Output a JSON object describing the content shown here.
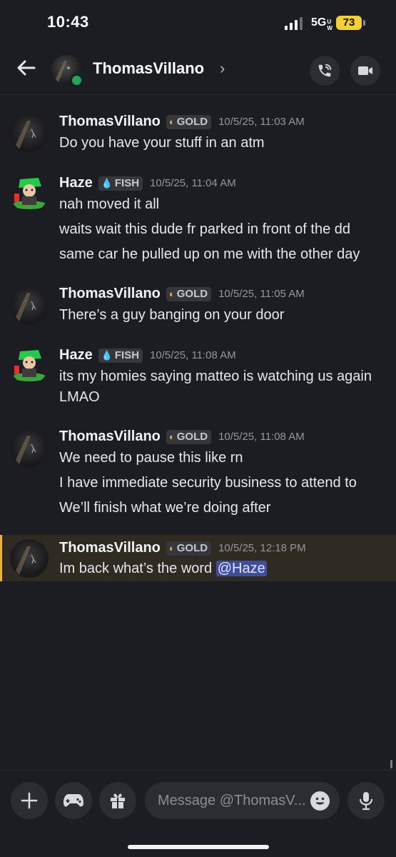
{
  "status_bar": {
    "time": "10:43",
    "network": "5G",
    "network_suffix": "UW",
    "battery": "73"
  },
  "header": {
    "name": "ThomasVillano",
    "chevron": "›"
  },
  "messages": [
    {
      "author": "ThomasVillano",
      "tag": "GOLD",
      "timestamp": "10/5/25, 11:03 AM",
      "lines": [
        "Do you have your stuff in an atm"
      ]
    },
    {
      "author": "Haze",
      "tag": "FISH",
      "timestamp": "10/5/25, 11:04 AM",
      "lines": [
        "nah moved it all",
        "waits wait this dude fr parked in front of the dd",
        "same car he pulled up on me with the other day"
      ]
    },
    {
      "author": "ThomasVillano",
      "tag": "GOLD",
      "timestamp": "10/5/25, 11:05 AM",
      "lines": [
        "There’s a guy banging on your door"
      ]
    },
    {
      "author": "Haze",
      "tag": "FISH",
      "timestamp": "10/5/25, 11:08 AM",
      "lines": [
        "its my homies saying matteo is watching us again",
        "LMAO"
      ]
    },
    {
      "author": "ThomasVillano",
      "tag": "GOLD",
      "timestamp": "10/5/25, 11:08 AM",
      "lines": [
        "We need to pause this like rn",
        "I have immediate security business to attend to",
        "We’ll finish what we’re doing after"
      ]
    },
    {
      "author": "ThomasVillano",
      "tag": "GOLD",
      "timestamp": "10/5/25, 12:18 PM",
      "lines": [
        "Im back what’s the word "
      ],
      "mention": "@Haze"
    }
  ],
  "composer": {
    "placeholder": "Message @ThomasV..."
  },
  "colors": {
    "background": "#1c1d22",
    "gold_tag": "#f0b232",
    "fish_tag": "#5fc1e8",
    "mention_bg": "#414d99",
    "online": "#23a55a"
  },
  "icons": [
    "back-arrow-icon",
    "chevron-right-icon",
    "phone-call-icon",
    "video-camera-icon",
    "plus-icon",
    "gamepad-icon",
    "gift-icon",
    "emoji-icon",
    "microphone-icon"
  ]
}
